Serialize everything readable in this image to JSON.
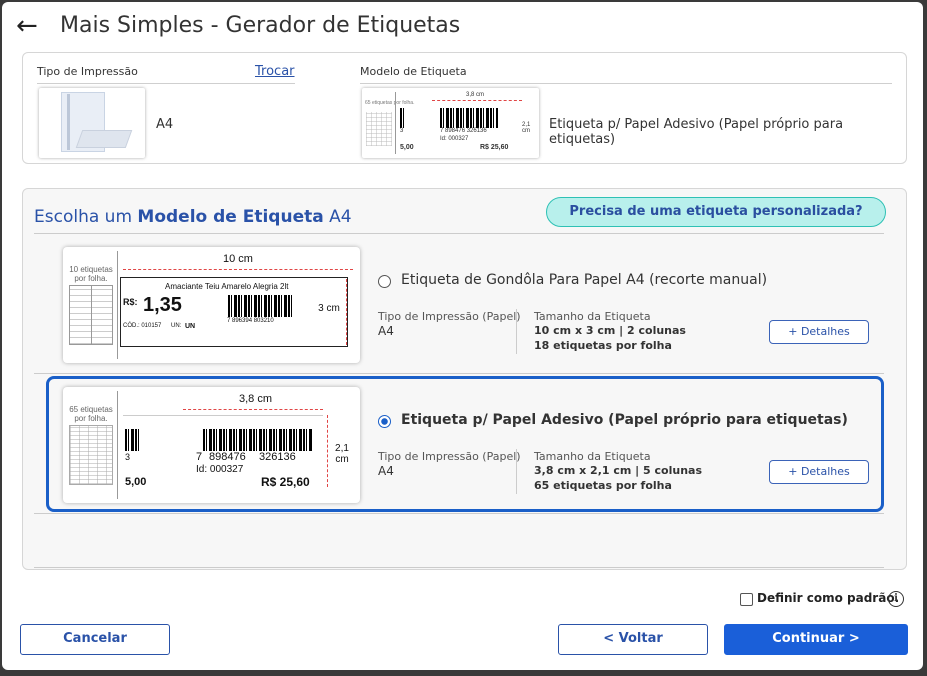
{
  "window": {
    "title": "Mais Simples - Gerador de Etiquetas"
  },
  "print_type": {
    "label": "Tipo de Impressão",
    "change_link": "Trocar",
    "value": "A4"
  },
  "label_model": {
    "label": "Modelo de Etiqueta",
    "value": "Etiqueta p/ Papel Adesivo (Papel próprio para etiquetas)"
  },
  "chooser": {
    "prefix": "Escolha um",
    "bold": "Modelo de Etiqueta",
    "suffix": "A4",
    "custom_button": "Precisa de uma etiqueta personalizada?"
  },
  "options": [
    {
      "title": "Etiqueta de Gondôla Para Papel A4 (recorte manual)",
      "selected": false,
      "print_type_label": "Tipo de Impressão (Papel)",
      "print_type_value": "A4",
      "size_label": "Tamanho da Etiqueta",
      "size_value": "10 cm x 3 cm | 2 colunas",
      "per_sheet": "18 etiquetas por folha",
      "details_button": "+ Detalhes",
      "preview": {
        "sheet_text": "10 etiquetas por folha.",
        "width_text": "10 cm",
        "height_text": "3 cm",
        "product": "Amaciante Teiu Amarelo Alegria 2lt",
        "currency": "R$:",
        "price": "1,35",
        "code_label": "CÓD.: 010157",
        "unit_label": "UN:",
        "unit_value": "UN",
        "barcode_digits": "7 896394 803210"
      }
    },
    {
      "title": "Etiqueta p/ Papel Adesivo (Papel próprio para etiquetas)",
      "selected": true,
      "print_type_label": "Tipo de Impressão (Papel)",
      "print_type_value": "A4",
      "size_label": "Tamanho da Etiqueta",
      "size_value": "3,8 cm x 2,1 cm | 5 colunas",
      "per_sheet": "65 etiquetas por folha",
      "details_button": "+ Detalhes",
      "preview": {
        "sheet_text": "65 etiquetas por folha.",
        "width_text": "3,8 cm",
        "height_text": "2,1 cm",
        "small_code": "3",
        "barcode_left": "7",
        "barcode_mid": "898476",
        "barcode_right": "326136",
        "id_text": "Id: 000327",
        "left_price": "5,00",
        "price": "R$ 25,60"
      }
    }
  ],
  "footer": {
    "default_label": "Definir como padrão.",
    "info_icon": "i",
    "cancel": "Cancelar",
    "back": "< Voltar",
    "continue": "Continuar >"
  },
  "icons": {
    "back": "←"
  },
  "colors": {
    "accent": "#1a5fd9",
    "link": "#2a52a8",
    "pill_bg": "#b8f0ec",
    "pill_border": "#2ec1b5",
    "dimension_red": "#e04545"
  }
}
